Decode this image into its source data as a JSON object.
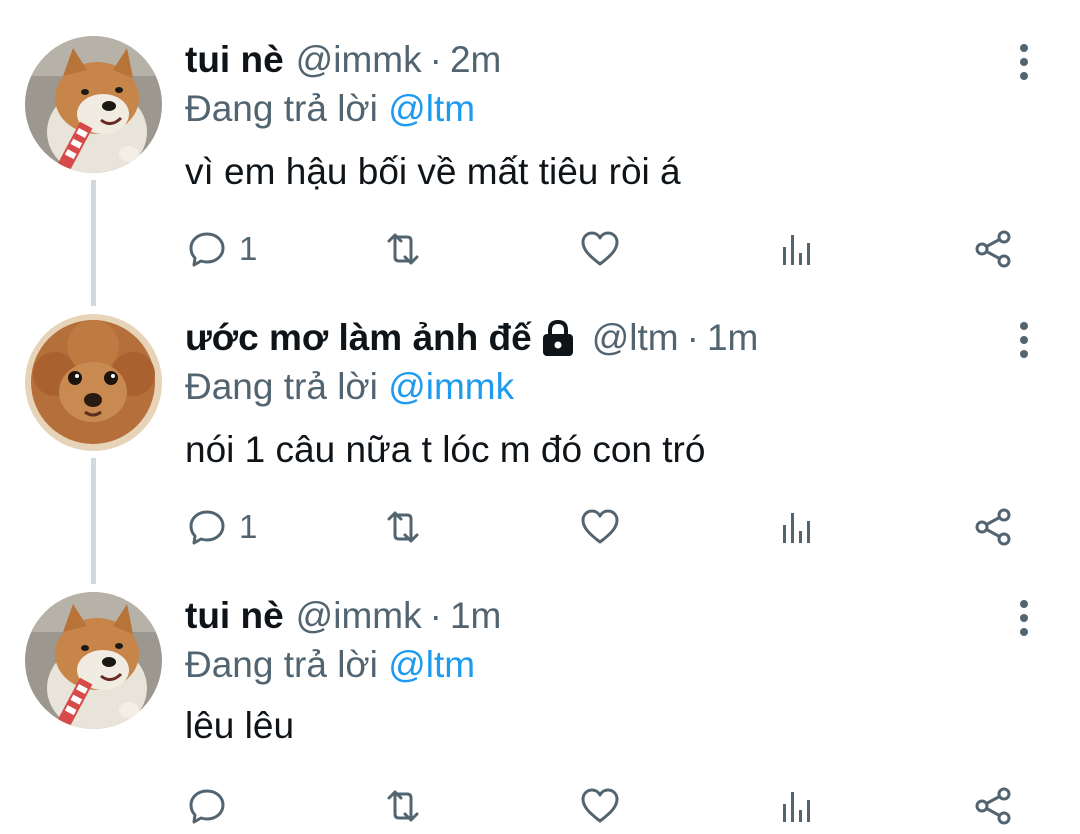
{
  "colors": {
    "text": "#0f1419",
    "secondary": "#536471",
    "link": "#1d9bf0",
    "thread_line": "#cfd9de"
  },
  "tweets": [
    {
      "display_name": "tui nè",
      "handle": "@immk",
      "separator": "·",
      "time": "2m",
      "reply_prefix": "Đang trả lời",
      "reply_mention": "@ltm",
      "text": "vì em hậu bối về mất tiêu ròi á",
      "reply_count": "1",
      "has_lock_icon": false,
      "avatar": "shiba-dog-avatar"
    },
    {
      "display_name": "ước mơ làm ảnh đế",
      "handle": "@ltm",
      "separator": "·",
      "time": "1m",
      "reply_prefix": "Đang trả lời",
      "reply_mention": "@immk",
      "text": "nói 1 câu nữa t lóc m đó con tró",
      "reply_count": "1",
      "has_lock_icon": true,
      "avatar": "poodle-dog-avatar"
    },
    {
      "display_name": "tui nè",
      "handle": "@immk",
      "separator": "·",
      "time": "1m",
      "reply_prefix": "Đang trả lời",
      "reply_mention": "@ltm",
      "text": "lêu lêu",
      "reply_count": "",
      "has_lock_icon": false,
      "avatar": "shiba-dog-avatar"
    }
  ],
  "icons": {
    "reply": "comment-icon",
    "retweet": "retweet-icon",
    "like": "heart-icon",
    "analytics": "analytics-icon",
    "share": "share-icon",
    "more": "more-vertical-icon",
    "lock": "lock-icon"
  }
}
